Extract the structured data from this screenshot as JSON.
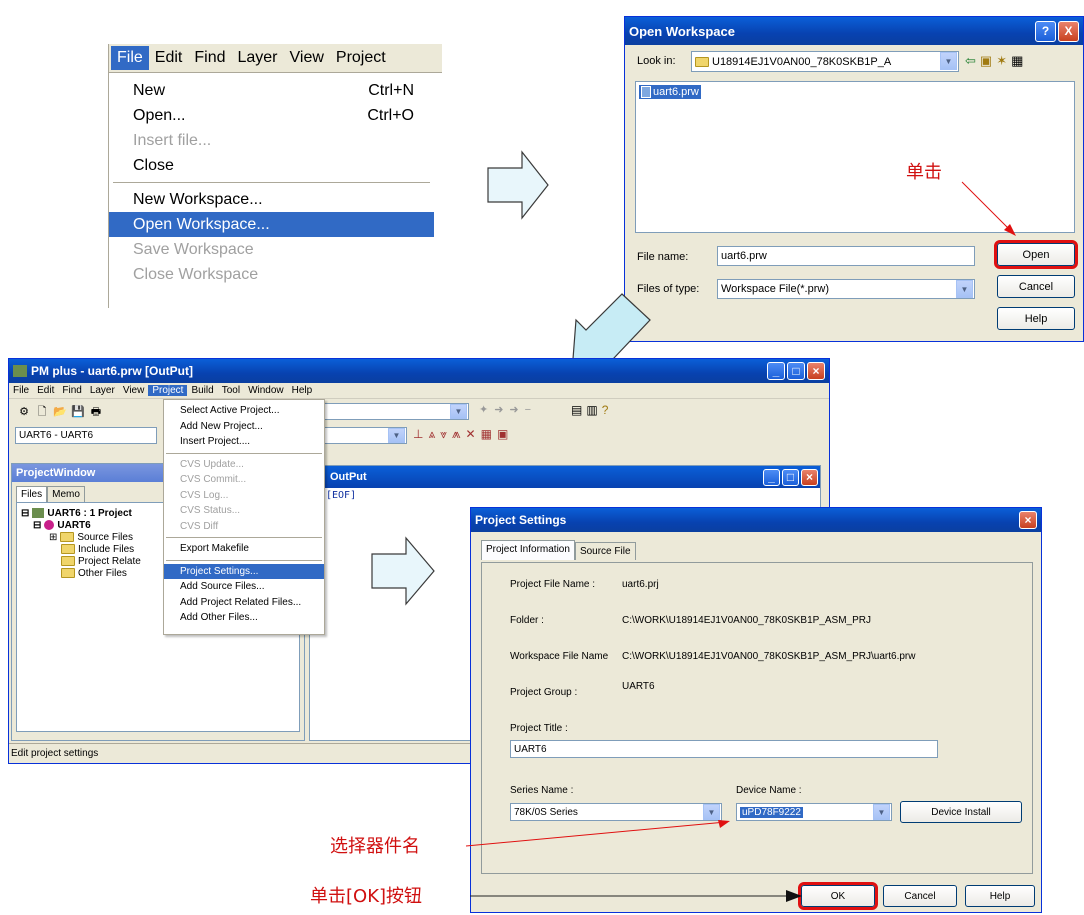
{
  "file_menu": {
    "bar": [
      "File",
      "Edit",
      "Find",
      "Layer",
      "View",
      "Project"
    ],
    "items": [
      {
        "label": "New",
        "shortcut": "Ctrl+N"
      },
      {
        "label": "Open...",
        "shortcut": "Ctrl+O"
      },
      {
        "label": "Insert file...",
        "shortcut": ""
      },
      {
        "label": "Close",
        "shortcut": ""
      },
      {
        "label": "New Workspace...",
        "shortcut": ""
      },
      {
        "label": "Open Workspace...",
        "shortcut": ""
      },
      {
        "label": "Save Workspace",
        "shortcut": ""
      },
      {
        "label": "Close Workspace",
        "shortcut": ""
      }
    ]
  },
  "open_ws": {
    "title": "Open Workspace",
    "help_btn": "?",
    "close_btn": "X",
    "look_in_label": "Look in:",
    "look_in_value": "U18914EJ1V0AN00_78K0SKB1P_A",
    "file_item": "uart6.prw",
    "file_name_label": "File name:",
    "file_name_value": "uart6.prw",
    "files_type_label": "Files of type:",
    "files_type_value": "Workspace File(*.prw)",
    "open_btn": "Open",
    "cancel_btn": "Cancel",
    "help_btn2": "Help"
  },
  "annot": {
    "click": "单击",
    "select_device": "选择器件名",
    "click_ok": "单击[OK]按钮"
  },
  "pm": {
    "title": "PM plus - uart6.prw [OutPut]",
    "menubar": [
      "File",
      "Edit",
      "Find",
      "Layer",
      "View",
      "Project",
      "Build",
      "Tool",
      "Window",
      "Help"
    ],
    "project_combo": "UART6 - UART6",
    "project_menu": [
      "Select Active Project...",
      "Add New Project...",
      "Insert Project....",
      "CVS Update...",
      "CVS Commit...",
      "CVS Log...",
      "CVS Status...",
      "CVS Diff",
      "Export Makefile",
      "Project Settings...",
      "Add Source Files...",
      "Add Project Related Files...",
      "Add Other Files..."
    ],
    "project_window_title": "ProjectWindow",
    "tabs": [
      "Files",
      "Memo"
    ],
    "tree": [
      "UART6 : 1 Project",
      "UART6",
      "Source Files",
      "Include Files",
      "Project Relate",
      "Other Files"
    ],
    "output_title": "OutPut",
    "output_text": "[EOF]",
    "status": "Edit project settings"
  },
  "ps": {
    "title": "Project Settings",
    "tabs": [
      "Project Information",
      "Source File"
    ],
    "file_name_label": "Project File Name :",
    "file_name": "uart6.prj",
    "folder_label": "Folder :",
    "folder": "C:\\WORK\\U18914EJ1V0AN00_78K0SKB1P_ASM_PRJ",
    "ws_label": "Workspace File Name",
    "ws": "C:\\WORK\\U18914EJ1V0AN00_78K0SKB1P_ASM_PRJ\\uart6.prw",
    "group_label": "Project Group :",
    "group": "UART6",
    "title_label": "Project Title :",
    "title_value": "UART6",
    "series_label": "Series Name :",
    "series_value": "78K/0S Series",
    "device_label": "Device Name :",
    "device_value": "uPD78F9222",
    "device_install": "Device Install",
    "ok": "OK",
    "cancel": "Cancel",
    "help": "Help"
  }
}
